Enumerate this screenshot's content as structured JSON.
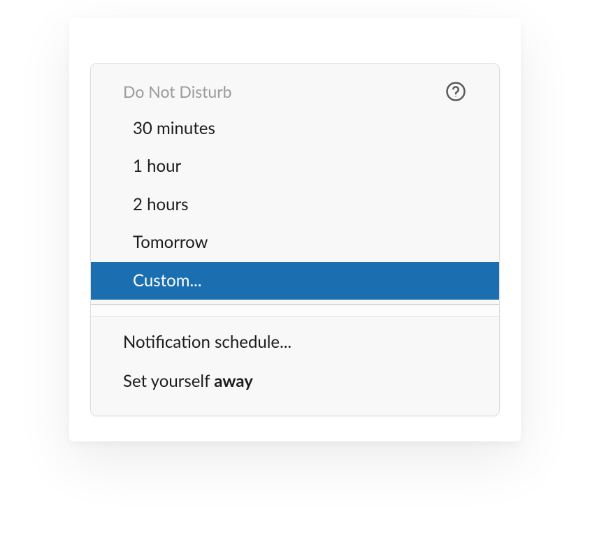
{
  "colors": {
    "selected_bg": "#1b6fb0",
    "selected_fg": "#ffffff",
    "panel_bg": "#f8f8f8",
    "border": "#dfdfdf",
    "header_fg": "#9b9b9b"
  },
  "menu": {
    "title": "Do Not Disturb",
    "items": [
      {
        "label": "30 minutes",
        "selected": false
      },
      {
        "label": "1 hour",
        "selected": false
      },
      {
        "label": "2 hours",
        "selected": false
      },
      {
        "label": "Tomorrow",
        "selected": false
      },
      {
        "label": "Custom...",
        "selected": true
      }
    ],
    "notification_schedule": "Notification schedule...",
    "set_away_prefix": "Set yourself ",
    "set_away_bold": "away"
  },
  "icons": {
    "help": "help-circle-icon"
  }
}
